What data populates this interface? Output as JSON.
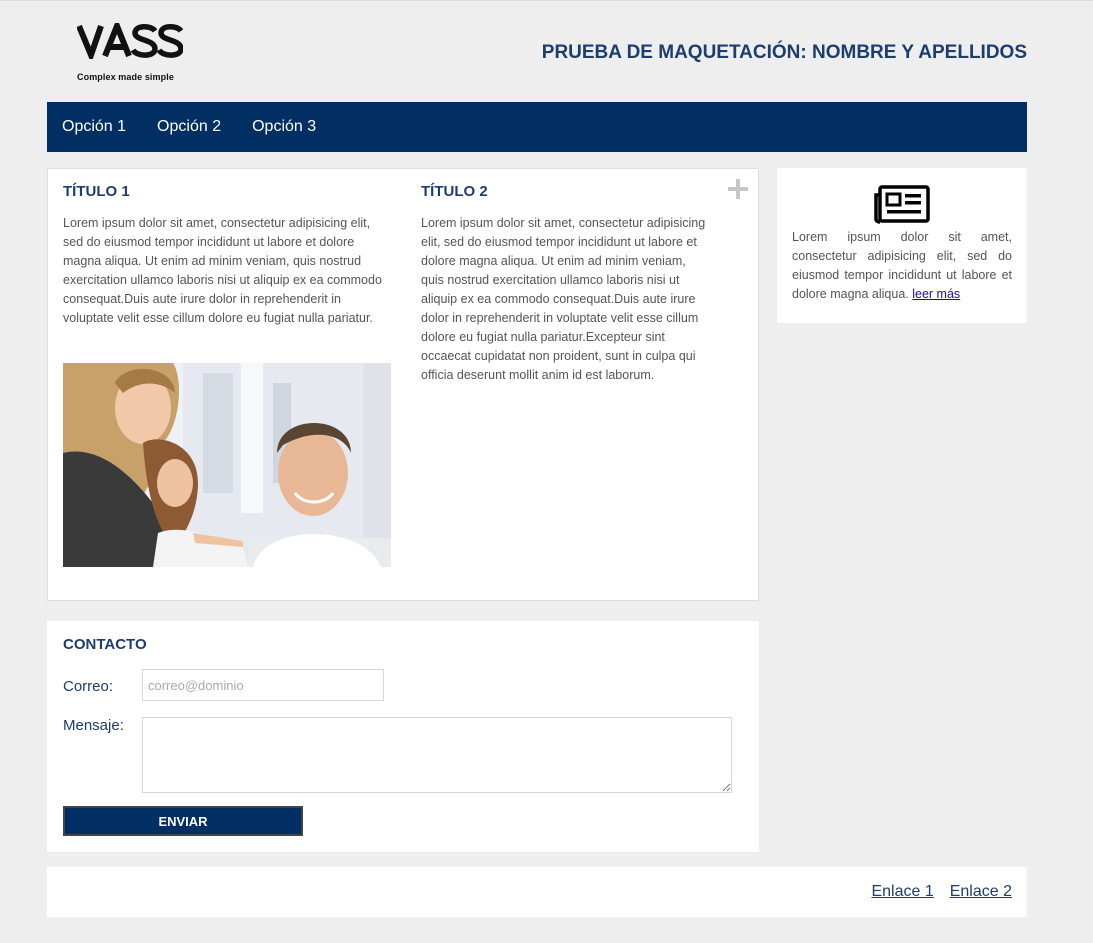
{
  "header": {
    "logo_text": "VASS",
    "tagline": "Complex made simple",
    "title": "PRUEBA DE MAQUETACIÓN: NOMBRE Y APELLIDOS"
  },
  "nav": {
    "items": [
      {
        "label": "Opción 1"
      },
      {
        "label": "Opción 2"
      },
      {
        "label": "Opción 3"
      }
    ]
  },
  "main": {
    "columns": [
      {
        "title": "TÍTULO 1",
        "text": "Lorem ipsum dolor sit amet, consectetur adipisicing elit, sed do eiusmod tempor incididunt ut labore et dolore magna aliqua. Ut enim ad minim veniam, quis nostrud exercitation ullamco laboris nisi ut aliquip ex ea commodo consequat.Duis aute irure dolor in reprehenderit in voluptate velit esse cillum dolore eu fugiat nulla pariatur."
      },
      {
        "title": "TÍTULO 2",
        "text": "Lorem ipsum dolor sit amet, consectetur adipisicing elit, sed do eiusmod tempor incididunt ut labore et dolore magna aliqua. Ut enim ad minim veniam, quis nostrud exercitation ullamco laboris nisi ut aliquip ex ea commodo consequat.Duis aute irure dolor in reprehenderit in voluptate velit esse cillum dolore eu fugiat nulla pariatur.Excepteur sint occaecat cupidatat non proident, sunt in culpa qui officia deserunt mollit anim id est laborum."
      }
    ],
    "expand_icon": "plus-icon",
    "image_icon": "office-team-photo"
  },
  "sidebar": {
    "icon": "newspaper-icon",
    "text": "Lorem ipsum dolor sit amet, consectetur adipisicing elit, sed do eiusmod tempor incididunt ut labore et dolore magna aliqua.",
    "link": "leer más"
  },
  "contact": {
    "title": "CONTACTO",
    "email_label": "Correo:",
    "email_placeholder": "correo@dominio",
    "email_value": "",
    "message_label": "Mensaje:",
    "message_value": "",
    "submit_label": "ENVIAR"
  },
  "footer": {
    "links": [
      {
        "label": "Enlace 1"
      },
      {
        "label": "Enlace 2"
      }
    ]
  },
  "colors": {
    "page_bg": "#eeeeee",
    "navy": "#012f63",
    "heading": "#1c3d6e",
    "body_text": "#555555",
    "link": "#1a0dab"
  }
}
